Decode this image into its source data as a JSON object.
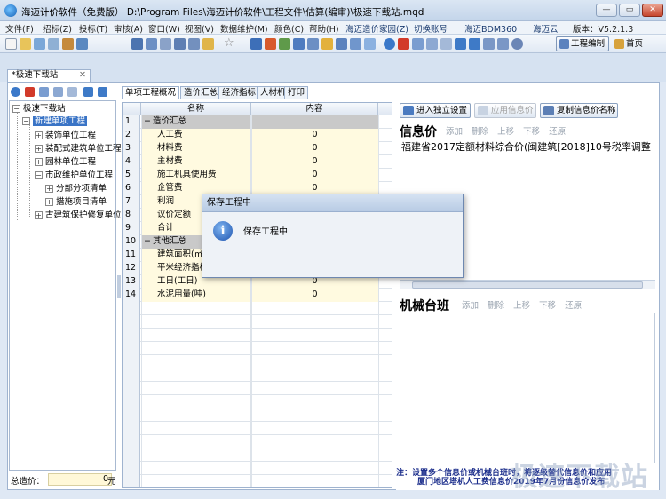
{
  "window": {
    "title": "海迈计价软件（免费版） D:\\Program Files\\海迈计价软件\\工程文件\\估算(编审)\\极速下载站.mqd",
    "controls": {
      "minimize": "—",
      "maximize": "▭",
      "close": "✕"
    }
  },
  "menu": {
    "items": [
      "文件(F)",
      "招标(Z)",
      "投标(T)",
      "审核(A)",
      "窗口(W)",
      "视图(V)",
      "数据维护(M)",
      "颜色(C)",
      "帮助(H)",
      "海迈造价家园(Z)",
      "切换账号",
      "海迈BDM360",
      "海迈云",
      "版本：V5.2.1.3"
    ]
  },
  "toolbar": {
    "project_edit_label": "工程编制",
    "home_label": "首页"
  },
  "document_tab": {
    "label": "*极速下载站",
    "close": "✕"
  },
  "tree": {
    "root": "极速下载站",
    "items": [
      {
        "label": "新建单项工程"
      },
      {
        "label": "装饰单位工程"
      },
      {
        "label": "装配式建筑单位工程"
      },
      {
        "label": "园林单位工程"
      },
      {
        "label": "市政维护单位工程"
      },
      {
        "label": "分部分项清单"
      },
      {
        "label": "措施项目清单"
      },
      {
        "label": "古建筑保护修复单位"
      }
    ],
    "total_label": "总造价：",
    "total_value": "0",
    "total_unit": "元"
  },
  "inner_tabs": [
    "单项工程概况",
    "造价汇总",
    "经济指标",
    "人材机",
    "打印"
  ],
  "grid": {
    "headers": {
      "name": "名称",
      "content": "内容"
    },
    "rows": [
      {
        "num": "1",
        "name": "造价汇总",
        "value": "",
        "kind": "group"
      },
      {
        "num": "2",
        "name": "人工费",
        "value": "0",
        "kind": "item"
      },
      {
        "num": "3",
        "name": "材料费",
        "value": "0",
        "kind": "item"
      },
      {
        "num": "4",
        "name": "主材费",
        "value": "0",
        "kind": "item"
      },
      {
        "num": "5",
        "name": "施工机具使用费",
        "value": "0",
        "kind": "item"
      },
      {
        "num": "6",
        "name": "企管费",
        "value": "0",
        "kind": "item"
      },
      {
        "num": "7",
        "name": "利润",
        "value": "",
        "kind": "item"
      },
      {
        "num": "8",
        "name": "议价定额",
        "value": "",
        "kind": "item"
      },
      {
        "num": "9",
        "name": "合计",
        "value": "",
        "kind": "item"
      },
      {
        "num": "10",
        "name": "其他汇总",
        "value": "",
        "kind": "group"
      },
      {
        "num": "11",
        "name": "建筑面积(㎡)",
        "value": "",
        "kind": "item"
      },
      {
        "num": "12",
        "name": "平米经济指标",
        "value": "",
        "kind": "item"
      },
      {
        "num": "13",
        "name": "工日(工日)",
        "value": "0",
        "kind": "item"
      },
      {
        "num": "14",
        "name": "水泥用量(吨)",
        "value": "0",
        "kind": "item"
      }
    ]
  },
  "right_panel": {
    "btn_enter": "进入独立设置",
    "btn_apply": "应用信息价",
    "btn_copy": "复制信息价名称",
    "info_title": "信息价",
    "info_ops": [
      "添加",
      "删除",
      "上移",
      "下移",
      "还原"
    ],
    "info_text": "福建省2017定额材料综合价(闽建筑[2018]10号税率调整",
    "mech_title": "机械台班",
    "mech_ops": [
      "添加",
      "删除",
      "上移",
      "下移",
      "还原"
    ],
    "note_line1": "注：设置多个信息价或机械台班时，将逐级替代信息价和应用",
    "note_line2": "厦门地区塔机人工费信息价2019年7月份信息价发布"
  },
  "dialog": {
    "title": "保存工程中",
    "message": "保存工程中",
    "icon": "i"
  },
  "watermark": "极速下载站"
}
